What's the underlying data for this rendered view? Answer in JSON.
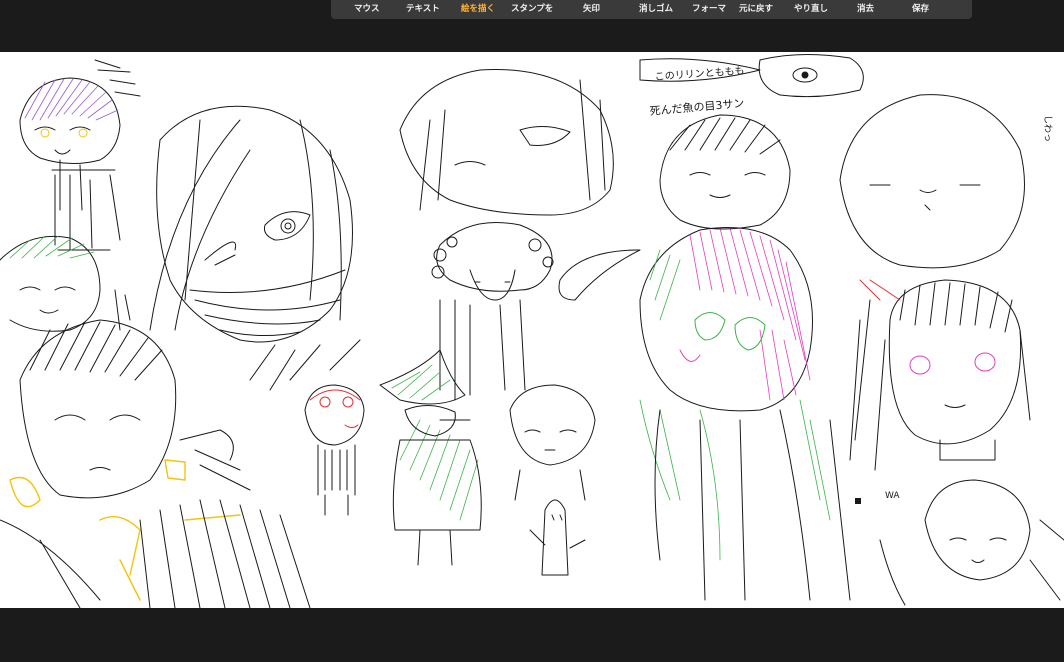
{
  "toolbar": {
    "tools": [
      {
        "id": "mouse",
        "label": "マウス"
      },
      {
        "id": "text",
        "label": "テキスト"
      },
      {
        "id": "draw",
        "label": "絵を描く",
        "active": true
      },
      {
        "id": "stamp",
        "label": "スタンプを"
      },
      {
        "id": "arrow",
        "label": "矢印"
      },
      {
        "id": "eraser",
        "label": "消しゴム"
      },
      {
        "id": "form",
        "label": "フォーマ"
      },
      {
        "id": "undo",
        "label": "元に戻す"
      },
      {
        "id": "redo",
        "label": "やり直し"
      },
      {
        "id": "clear",
        "label": "消去"
      },
      {
        "id": "save",
        "label": "保存"
      }
    ],
    "active_color": "#ffb233"
  },
  "canvas": {
    "handwritten_notes": [
      "このリリンとももも",
      "死んだ魚の目3サン",
      "しわっ",
      "WA"
    ],
    "colors": {
      "ink": "#1a1a1a",
      "purple": "#9b59d6",
      "pink": "#e040c0",
      "green": "#3cb34a",
      "yellow": "#f2c40a",
      "red": "#e03030"
    }
  }
}
